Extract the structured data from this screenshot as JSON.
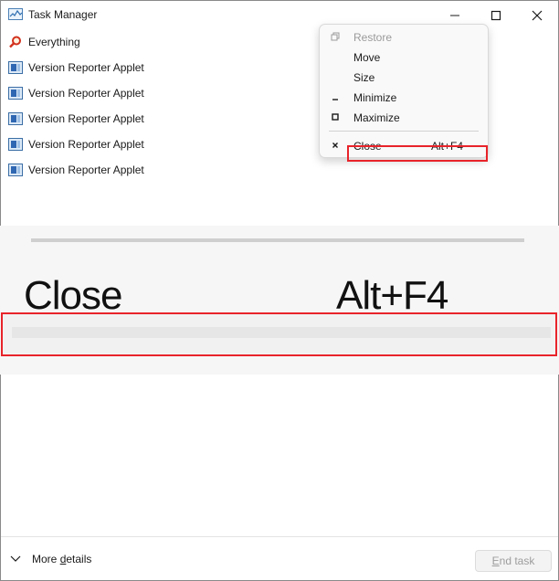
{
  "window": {
    "title": "Task Manager"
  },
  "processes": [
    {
      "name": "Everything",
      "icon": "magnifier-icon"
    },
    {
      "name": "Version Reporter Applet",
      "icon": "applet-icon"
    },
    {
      "name": "Version Reporter Applet",
      "icon": "applet-icon"
    },
    {
      "name": "Version Reporter Applet",
      "icon": "applet-icon"
    },
    {
      "name": "Version Reporter Applet",
      "icon": "applet-icon"
    },
    {
      "name": "Version Reporter Applet",
      "icon": "applet-icon"
    }
  ],
  "context_menu": {
    "items": [
      {
        "label": "Restore",
        "icon": "restore-icon",
        "disabled": true
      },
      {
        "label": "Move",
        "icon": "",
        "disabled": false
      },
      {
        "label": "Size",
        "icon": "",
        "disabled": false
      },
      {
        "label": "Minimize",
        "icon": "minimize-icon",
        "disabled": false
      },
      {
        "label": "Maximize",
        "icon": "maximize-icon",
        "disabled": false
      }
    ],
    "close": {
      "label": "Close",
      "accelerator": "Alt+F4",
      "icon": "close-icon"
    }
  },
  "zoom_inset": {
    "label": "Close",
    "accelerator": "Alt+F4"
  },
  "footer": {
    "more_details_prefix": "More ",
    "more_details_underlined": "d",
    "more_details_suffix": "etails",
    "end_task_underlined": "E",
    "end_task_suffix": "nd task"
  },
  "colors": {
    "highlight": "#e8232a",
    "disabled_text": "#9a9a9a",
    "menu_bg": "#f9f9f9"
  }
}
